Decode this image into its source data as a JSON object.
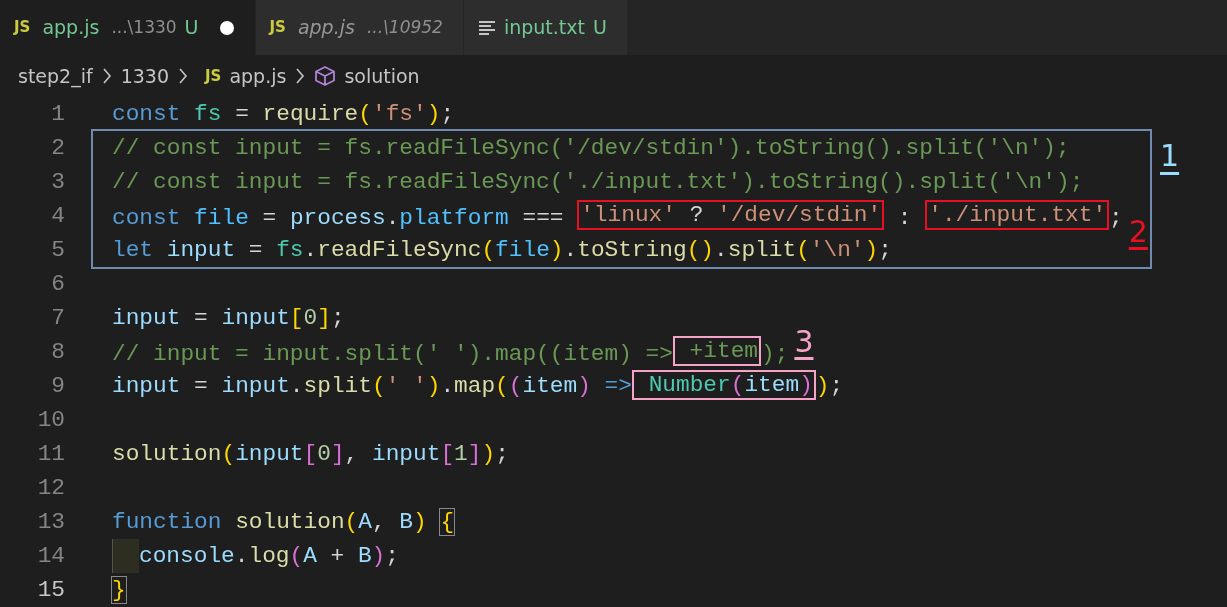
{
  "tabs": [
    {
      "kind": "js",
      "icon_text": "JS",
      "label": "app.js",
      "description": "...\\1330",
      "git": "U",
      "selected": true,
      "preview": false,
      "modified": true
    },
    {
      "kind": "js",
      "icon_text": "JS",
      "label": "app.js",
      "description": "...\\10952",
      "selected": false,
      "preview": true,
      "modified": false
    },
    {
      "kind": "text",
      "label": "input.txt",
      "git": "U",
      "selected": false,
      "preview": false,
      "modified": false
    }
  ],
  "breadcrumb": [
    {
      "kind": "folder",
      "text": "step2_if"
    },
    {
      "kind": "folder",
      "text": "1330"
    },
    {
      "kind": "js",
      "icon_text": "JS",
      "text": "app.js"
    },
    {
      "kind": "symbol",
      "text": "solution"
    }
  ],
  "code": [
    {
      "number": "1",
      "tokens": [
        {
          "kind": "k",
          "text": "const "
        },
        {
          "kind": "t",
          "text": "fs"
        },
        {
          "kind": "p",
          "text": " = "
        },
        {
          "kind": "f",
          "text": "require"
        },
        {
          "kind": "b1",
          "text": "("
        },
        {
          "kind": "s",
          "text": "'fs'"
        },
        {
          "kind": "b1",
          "text": ")"
        },
        {
          "kind": "p",
          "text": ";"
        }
      ]
    },
    {
      "color": "#6f8bb0",
      "label": {
        "text": "1",
        "color": "#9cdcfe"
      },
      "lines": [
        {
          "number": "2",
          "tokens": [
            {
              "kind": "m",
              "text": "// const input = fs.readFileSync('/dev/stdin').toString().split('\\n');"
            }
          ]
        },
        {
          "number": "3",
          "tokens": [
            {
              "kind": "m",
              "text": "// const input = fs.readFileSync('./input.txt').toString().split('\\n');"
            }
          ]
        },
        {
          "number": "4",
          "note": {
            "text": "2",
            "color": "#e81123",
            "kind": "low"
          },
          "tokens": [
            {
              "kind": "k",
              "text": "const "
            },
            {
              "kind": "c",
              "text": "file"
            },
            {
              "kind": "p",
              "text": " = "
            },
            {
              "kind": "v",
              "text": "process"
            },
            {
              "kind": "p",
              "text": "."
            },
            {
              "kind": "c",
              "text": "platform"
            },
            {
              "kind": "p",
              "text": " === "
            },
            {
              "kind": "box",
              "color": "#e81123",
              "tokens": [
                {
                  "kind": "s",
                  "text": "'linux'"
                },
                {
                  "kind": "p",
                  "text": " ? "
                },
                {
                  "kind": "s",
                  "text": "'/dev/stdin'"
                }
              ]
            },
            {
              "kind": "p",
              "text": " : "
            },
            {
              "kind": "box",
              "color": "#e81123",
              "tokens": [
                {
                  "kind": "s",
                  "text": "'./input.txt'"
                }
              ]
            },
            {
              "kind": "p",
              "text": ";"
            }
          ]
        },
        {
          "number": "5",
          "tokens": [
            {
              "kind": "k",
              "text": "let "
            },
            {
              "kind": "v",
              "text": "input"
            },
            {
              "kind": "p",
              "text": " = "
            },
            {
              "kind": "t",
              "text": "fs"
            },
            {
              "kind": "p",
              "text": "."
            },
            {
              "kind": "f",
              "text": "readFileSync"
            },
            {
              "kind": "b1",
              "text": "("
            },
            {
              "kind": "c",
              "text": "file"
            },
            {
              "kind": "b1",
              "text": ")"
            },
            {
              "kind": "p",
              "text": "."
            },
            {
              "kind": "f",
              "text": "toString"
            },
            {
              "kind": "b1",
              "text": "()"
            },
            {
              "kind": "p",
              "text": "."
            },
            {
              "kind": "f",
              "text": "split"
            },
            {
              "kind": "b1",
              "text": "("
            },
            {
              "kind": "s",
              "text": "'\\n'"
            },
            {
              "kind": "b1",
              "text": ")"
            },
            {
              "kind": "p",
              "text": ";"
            }
          ]
        }
      ]
    },
    {
      "number": "6"
    },
    {
      "number": "7",
      "tokens": [
        {
          "kind": "v",
          "text": "input"
        },
        {
          "kind": "p",
          "text": " = "
        },
        {
          "kind": "v",
          "text": "input"
        },
        {
          "kind": "b1",
          "text": "["
        },
        {
          "kind": "n",
          "text": "0"
        },
        {
          "kind": "b1",
          "text": "]"
        },
        {
          "kind": "p",
          "text": ";"
        }
      ]
    },
    {
      "number": "8",
      "note": {
        "text": "3",
        "color": "#f5a3c7",
        "kind": "high"
      },
      "tokens": [
        {
          "kind": "m",
          "text": "// input = input.split(' ').map((item) =>"
        },
        {
          "kind": "box",
          "color": "#f5a3c7",
          "tokens": [
            {
              "kind": "m",
              "text": " +item"
            }
          ]
        },
        {
          "kind": "m",
          "text": ");"
        }
      ]
    },
    {
      "number": "9",
      "tokens": [
        {
          "kind": "v",
          "text": "input"
        },
        {
          "kind": "p",
          "text": " = "
        },
        {
          "kind": "v",
          "text": "input"
        },
        {
          "kind": "p",
          "text": "."
        },
        {
          "kind": "f",
          "text": "split"
        },
        {
          "kind": "b1",
          "text": "("
        },
        {
          "kind": "s",
          "text": "' '"
        },
        {
          "kind": "b1",
          "text": ")"
        },
        {
          "kind": "p",
          "text": "."
        },
        {
          "kind": "f",
          "text": "map"
        },
        {
          "kind": "b1",
          "text": "("
        },
        {
          "kind": "b2",
          "text": "("
        },
        {
          "kind": "v",
          "text": "item"
        },
        {
          "kind": "b2",
          "text": ") "
        },
        {
          "kind": "k",
          "text": "=>"
        },
        {
          "kind": "box",
          "color": "#f5a3c7",
          "tokens": [
            {
              "kind": "t",
              "text": " Number"
            },
            {
              "kind": "b2",
              "text": "("
            },
            {
              "kind": "v",
              "text": "item"
            },
            {
              "kind": "b2",
              "text": ")"
            }
          ]
        },
        {
          "kind": "b1",
          "text": ")"
        },
        {
          "kind": "p",
          "text": ";"
        }
      ]
    },
    {
      "number": "10"
    },
    {
      "number": "11",
      "tokens": [
        {
          "kind": "f",
          "text": "solution"
        },
        {
          "kind": "b1",
          "text": "("
        },
        {
          "kind": "v",
          "text": "input"
        },
        {
          "kind": "b2",
          "text": "["
        },
        {
          "kind": "n",
          "text": "0"
        },
        {
          "kind": "b2",
          "text": "]"
        },
        {
          "kind": "p",
          "text": ", "
        },
        {
          "kind": "v",
          "text": "input"
        },
        {
          "kind": "b2",
          "text": "["
        },
        {
          "kind": "n",
          "text": "1"
        },
        {
          "kind": "b2",
          "text": "]"
        },
        {
          "kind": "b1",
          "text": ")"
        },
        {
          "kind": "p",
          "text": ";"
        }
      ]
    },
    {
      "number": "12"
    },
    {
      "number": "13",
      "tokens": [
        {
          "kind": "k",
          "text": "function "
        },
        {
          "kind": "f",
          "text": "solution"
        },
        {
          "kind": "b1",
          "text": "("
        },
        {
          "kind": "v",
          "text": "A"
        },
        {
          "kind": "p",
          "text": ", "
        },
        {
          "kind": "v",
          "text": "B"
        },
        {
          "kind": "b1",
          "text": ") "
        },
        {
          "kind": "bm",
          "text": "{"
        }
      ]
    },
    {
      "number": "14",
      "indent": true,
      "tokens": [
        {
          "kind": "v",
          "text": "console"
        },
        {
          "kind": "p",
          "text": "."
        },
        {
          "kind": "f",
          "text": "log"
        },
        {
          "kind": "b2",
          "text": "("
        },
        {
          "kind": "v",
          "text": "A"
        },
        {
          "kind": "p",
          "text": " + "
        },
        {
          "kind": "v",
          "text": "B"
        },
        {
          "kind": "b2",
          "text": ")"
        },
        {
          "kind": "p",
          "text": ";"
        }
      ]
    },
    {
      "number": "15",
      "current": true,
      "tokens": [
        {
          "kind": "bm",
          "text": "}"
        }
      ]
    }
  ]
}
